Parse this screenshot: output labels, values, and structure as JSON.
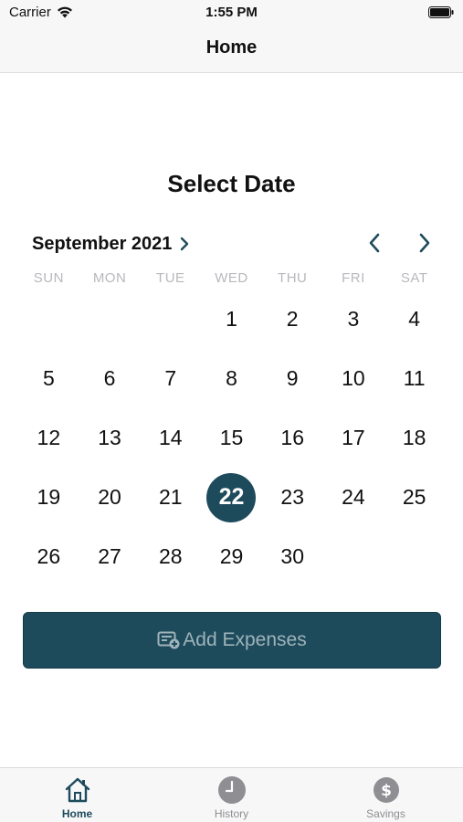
{
  "status_bar": {
    "carrier": "Carrier",
    "time": "1:55 PM",
    "wifi_icon": "wifi-icon",
    "battery_icon": "battery-icon"
  },
  "nav": {
    "title": "Home"
  },
  "calendar": {
    "title": "Select Date",
    "month_label": "September 2021",
    "weekdays": [
      "SUN",
      "MON",
      "TUE",
      "WED",
      "THU",
      "FRI",
      "SAT"
    ],
    "leading_blanks": 3,
    "days": [
      "1",
      "2",
      "3",
      "4",
      "5",
      "6",
      "7",
      "8",
      "9",
      "10",
      "11",
      "12",
      "13",
      "14",
      "15",
      "16",
      "17",
      "18",
      "19",
      "20",
      "21",
      "22",
      "23",
      "24",
      "25",
      "26",
      "27",
      "28",
      "29",
      "30"
    ],
    "selected_day": "22"
  },
  "add_button": {
    "label": "Add Expenses",
    "icon": "expense-add-icon"
  },
  "tabs": [
    {
      "label": "Home",
      "icon": "home-icon",
      "active": true
    },
    {
      "label": "History",
      "icon": "clock-icon",
      "active": false
    },
    {
      "label": "Savings",
      "icon": "dollar-icon",
      "active": false
    }
  ],
  "colors": {
    "accent": "#1e4b5c",
    "weekday_text": "#b8b8bd",
    "tab_inactive": "#8e8e93",
    "bar_background": "#f7f7f7"
  }
}
